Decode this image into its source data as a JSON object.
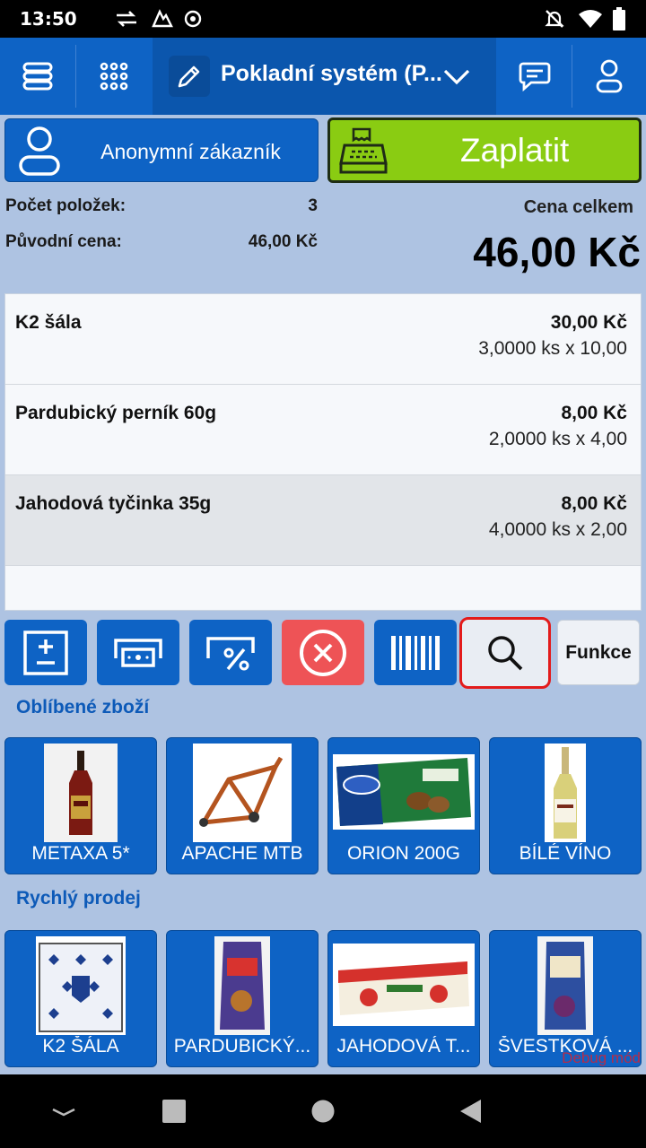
{
  "status": {
    "time": "13:50"
  },
  "appbar": {
    "title": "Pokladní systém (P..."
  },
  "customer": {
    "label": "Anonymní zákazník"
  },
  "pay": {
    "label": "Zaplatit"
  },
  "summary": {
    "items_label": "Počet položek:",
    "items_value": "3",
    "orig_label": "Původní cena:",
    "orig_value": "46,00 Kč",
    "total_label": "Cena celkem",
    "total_value": "46,00 Kč"
  },
  "cart": [
    {
      "name": "K2 šála",
      "price": "30,00 Kč",
      "qty": "3,0000 ks x 10,00"
    },
    {
      "name": "Pardubický perník 60g",
      "price": "8,00 Kč",
      "qty": "2,0000 ks x 4,00"
    },
    {
      "name": "Jahodová tyčinka 35g",
      "price": "8,00 Kč",
      "qty": "4,0000 ks x 2,00"
    }
  ],
  "actions": {
    "functions_label": "Funkce"
  },
  "favorites": {
    "title": "Oblíbené zboží",
    "items": [
      {
        "label": "METAXA 5*"
      },
      {
        "label": "APACHE MTB"
      },
      {
        "label": "ORION 200G"
      },
      {
        "label": "BÍLÉ VÍNO"
      }
    ]
  },
  "quick_sale": {
    "title": "Rychlý prodej",
    "items": [
      {
        "label": "K2 ŠÁLA"
      },
      {
        "label": "PARDUBICKÝ..."
      },
      {
        "label": "JAHODOVÁ T..."
      },
      {
        "label": "ŠVESTKOVÁ ..."
      }
    ]
  },
  "debug": "Debug mód",
  "colors": {
    "primary": "#0e63c5",
    "pay": "#8acc12",
    "cancel": "#ee5356",
    "background": "#aec3e2",
    "highlight": "#e31b1b"
  }
}
